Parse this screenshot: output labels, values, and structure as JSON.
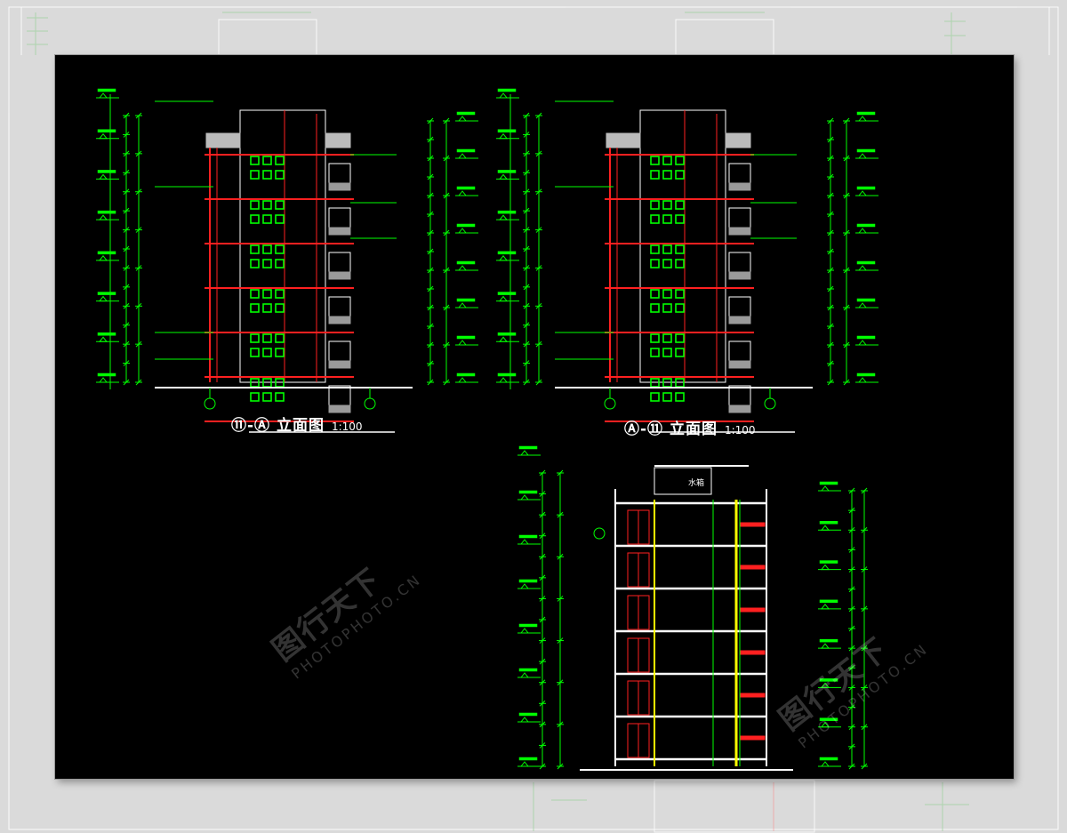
{
  "drawing": {
    "elevation_1": {
      "title": "⑪-Ⓐ 立面图",
      "scale": "1:100"
    },
    "elevation_2": {
      "title": "Ⓐ-⑪ 立面图",
      "scale": "1:100"
    },
    "section": {
      "roof_label": "水箱"
    }
  },
  "watermark": {
    "mark": "图行天下",
    "domain": "PHOTOPHOTO.CN"
  },
  "colors": {
    "background": "#000000",
    "dimension": "#00ff00",
    "wall": "#ff2020",
    "outline": "#ffffff",
    "accent": "#ffff00",
    "page": "#dadada"
  }
}
